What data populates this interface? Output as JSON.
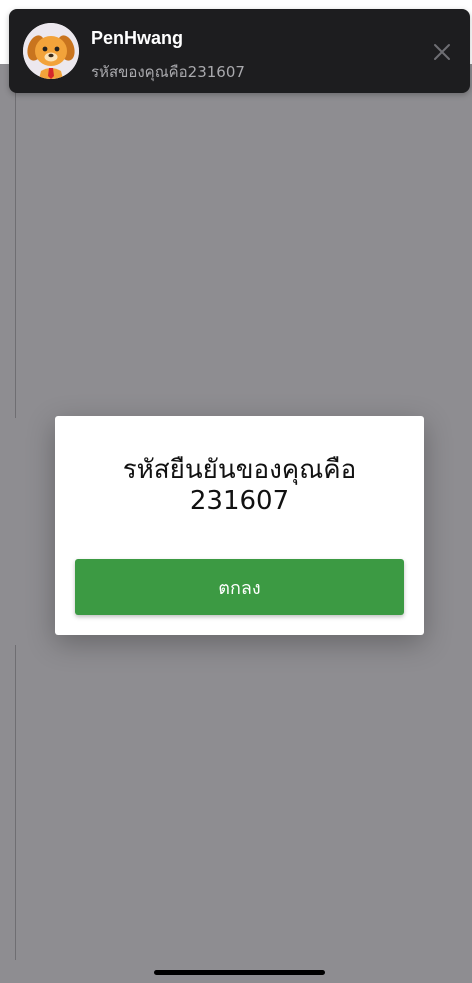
{
  "notification": {
    "sender": "PenHwang",
    "message": "รหัสของคุณคือ231607",
    "avatar_icon": "dog-avatar-icon",
    "close_icon": "close-icon"
  },
  "dialog": {
    "line1": "รหัสยืนยันของคุณคือ",
    "line2": "231607",
    "ok_label": "ตกลง"
  },
  "colors": {
    "accent": "#3c9a43",
    "backdrop": "#8e8d91",
    "notification_bg": "#1d1d1f"
  }
}
